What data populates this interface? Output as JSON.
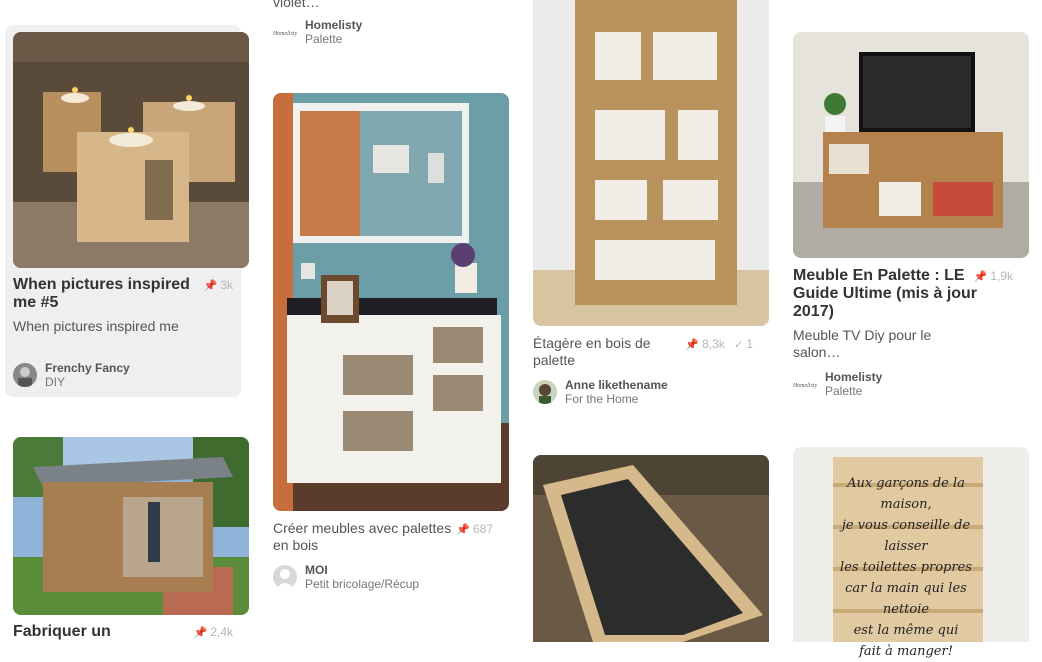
{
  "pins": [
    {
      "id": "candles",
      "title": "When pictures inspired me #5",
      "description": "When pictures inspired me",
      "repins": "3k",
      "user": "Frenchy Fancy",
      "board": "DIY",
      "image_icon": "candle-blocks-image"
    },
    {
      "id": "chicken-coop",
      "title": "Fabriquer un",
      "repins": "2,4k",
      "image_icon": "pallet-chicken-coop-image"
    },
    {
      "id": "top-partial",
      "description": "violet…",
      "user": "Homelisty",
      "board": "Palette",
      "logo_text": "Homelisty"
    },
    {
      "id": "entry-furniture",
      "description": "Créer meubles avec palettes en bois",
      "repins": "687",
      "user": "MOI",
      "board": "Petit bricolage/Récup",
      "image_icon": "white-pallet-console-image"
    },
    {
      "id": "shelf",
      "description": "Étagère en bois de palette",
      "repins": "8,3k",
      "likes": "1",
      "user": "Anne likethename",
      "board": "For the Home",
      "image_icon": "pallet-bookshelf-image"
    },
    {
      "id": "planter",
      "image_icon": "pallet-planter-box-image"
    },
    {
      "id": "tv-stand",
      "title": "Meuble En Palette : LE Guide Ultime (mis à jour 2017)",
      "description": "Meuble TV Diy pour le salon…",
      "repins": "1,9k",
      "user": "Homelisty",
      "board": "Palette",
      "logo_text": "Homelisty",
      "image_icon": "pallet-tv-stand-image"
    },
    {
      "id": "sign",
      "image_icon": "pallet-sign-image",
      "sign_lines": [
        "Aux garçons de la maison,",
        "je vous conseille de laisser",
        "les toilettes propres",
        "car la main qui les nettoie",
        "est la même qui",
        "fait à manger!"
      ]
    }
  ],
  "icons": {
    "repin": "pin-icon",
    "like": "check-icon"
  },
  "colors": {
    "hover_bg": "#efefef",
    "stat_gray": "#b5b5b5"
  }
}
